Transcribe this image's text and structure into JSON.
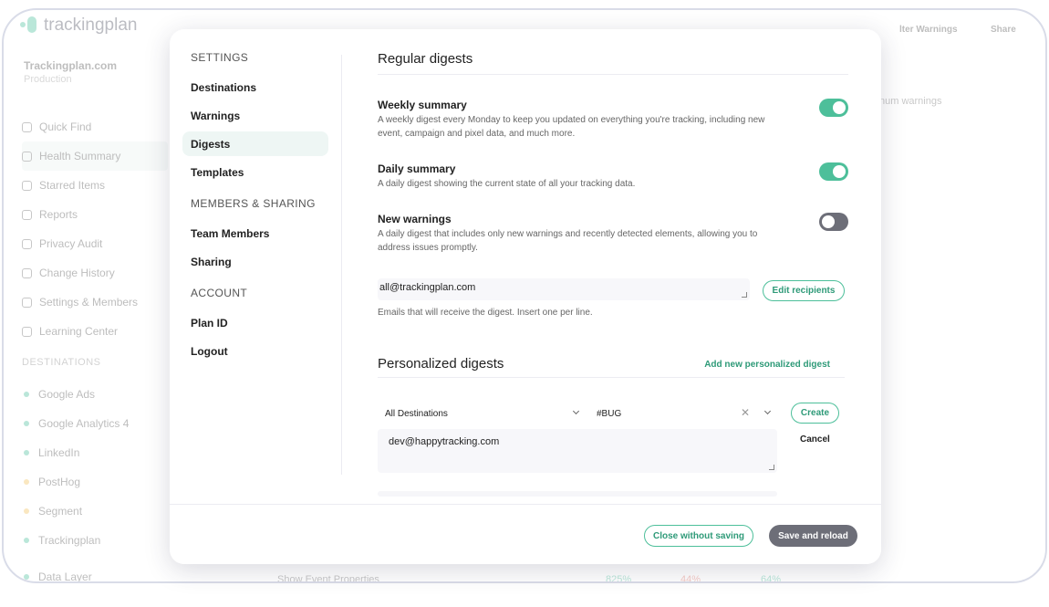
{
  "background": {
    "logo_text": "trackingplan",
    "org_name": "Trackingplan.com",
    "org_env": "Production",
    "nav": [
      {
        "label": "Quick Find",
        "icon": "search-icon"
      },
      {
        "label": "Health Summary",
        "icon": "pulse-icon"
      },
      {
        "label": "Starred Items",
        "icon": "star-icon"
      },
      {
        "label": "Reports",
        "icon": "report-icon"
      },
      {
        "label": "Privacy Audit",
        "icon": "shield-icon"
      },
      {
        "label": "Change History",
        "icon": "history-icon"
      },
      {
        "label": "Settings & Members",
        "icon": "gear-icon"
      },
      {
        "label": "Learning Center",
        "icon": "book-icon"
      }
    ],
    "destinations_heading": "DESTINATIONS",
    "destinations": [
      {
        "label": "Google Ads",
        "color": "#2bb38a"
      },
      {
        "label": "Google Analytics 4",
        "color": "#2bb38a"
      },
      {
        "label": "LinkedIn",
        "color": "#2bb38a"
      },
      {
        "label": "PostHog",
        "color": "#f0b43c"
      },
      {
        "label": "Segment",
        "color": "#f0b43c"
      },
      {
        "label": "Trackingplan",
        "color": "#2bb38a"
      },
      {
        "label": "Data Layer",
        "color": "#2bb38a"
      }
    ],
    "top_filter_warnings": "lter Warnings",
    "top_share": "Share",
    "minimum_warnings": "num warnings",
    "bottom_row_label": "Show Event Properties",
    "bottom_pcts": [
      "825%",
      "44%",
      "64%"
    ]
  },
  "modal": {
    "sidebar": {
      "settings_heading": "SETTINGS",
      "settings_items": [
        "Destinations",
        "Warnings",
        "Digests",
        "Templates"
      ],
      "members_heading": "MEMBERS & SHARING",
      "members_items": [
        "Team Members",
        "Sharing"
      ],
      "account_heading": "ACCOUNT",
      "account_items": [
        "Plan ID",
        "Logout"
      ],
      "active": "Digests"
    },
    "regular": {
      "title": "Regular digests",
      "weekly_title": "Weekly summary",
      "weekly_desc": "A weekly digest every Monday to keep you updated on everything you're tracking, including new event, campaign and pixel data, and much more.",
      "weekly_on": true,
      "daily_title": "Daily summary",
      "daily_desc": "A daily digest showing the current state of all your tracking data.",
      "daily_on": true,
      "warnings_title": "New warnings",
      "warnings_desc": "A daily digest that includes only new warnings and recently detected elements, allowing you to address issues promptly.",
      "warnings_on": false,
      "emails_value": "all@trackingplan.com",
      "edit_recipients": "Edit recipients",
      "emails_hint": "Emails that will receive the digest. Insert one per line."
    },
    "personalized": {
      "title": "Personalized digests",
      "add_link": "Add new personalized digest",
      "destination_select": "All Destinations",
      "tag_select": "#BUG",
      "create_label": "Create",
      "cancel_label": "Cancel",
      "email_value": "dev@happytracking.com"
    },
    "footer": {
      "close_label": "Close without saving",
      "save_label": "Save and reload"
    },
    "colors": {
      "accent": "#4dbf9a",
      "toggle_off": "#6d6e78"
    }
  }
}
